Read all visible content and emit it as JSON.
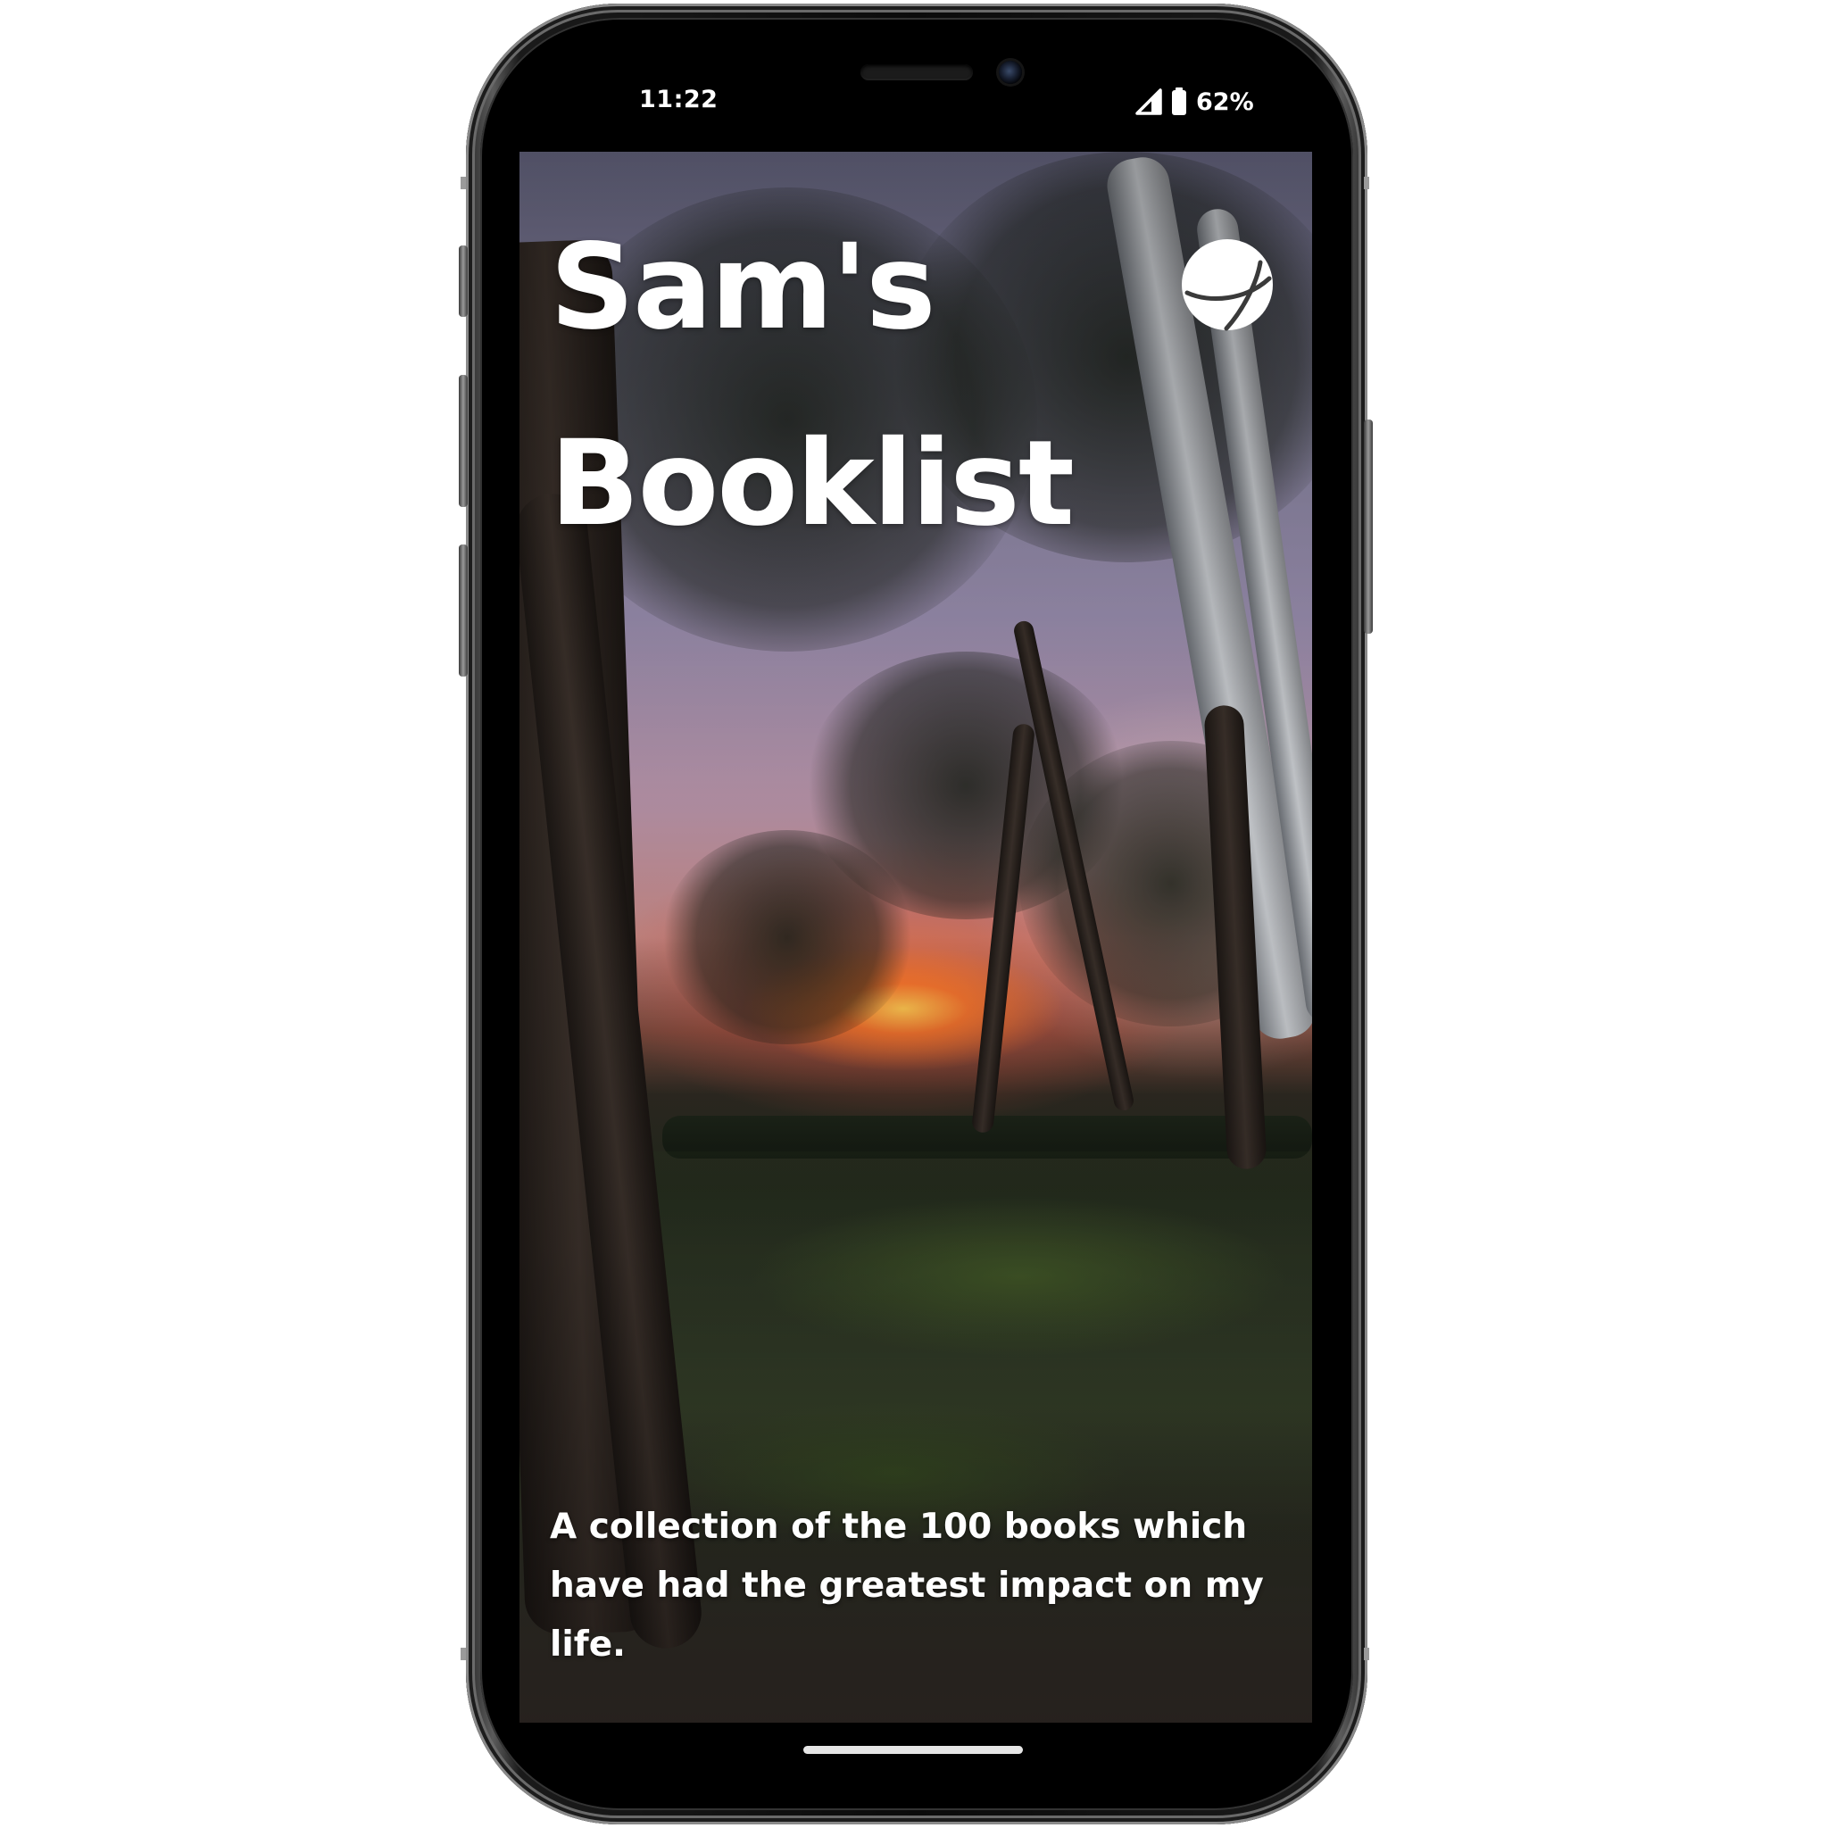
{
  "status_bar": {
    "time": "11:22",
    "battery": "62%",
    "icons": [
      "signal-icon",
      "battery-icon"
    ]
  },
  "app": {
    "title_line1": "Sam's",
    "title_line2": "Booklist",
    "subtitle": "A collection of the 100 books which have had the greatest impact on my life.",
    "logo": "globe-logo-icon"
  },
  "colors": {
    "text": "#ffffff",
    "frame": "#0b0b0b"
  }
}
